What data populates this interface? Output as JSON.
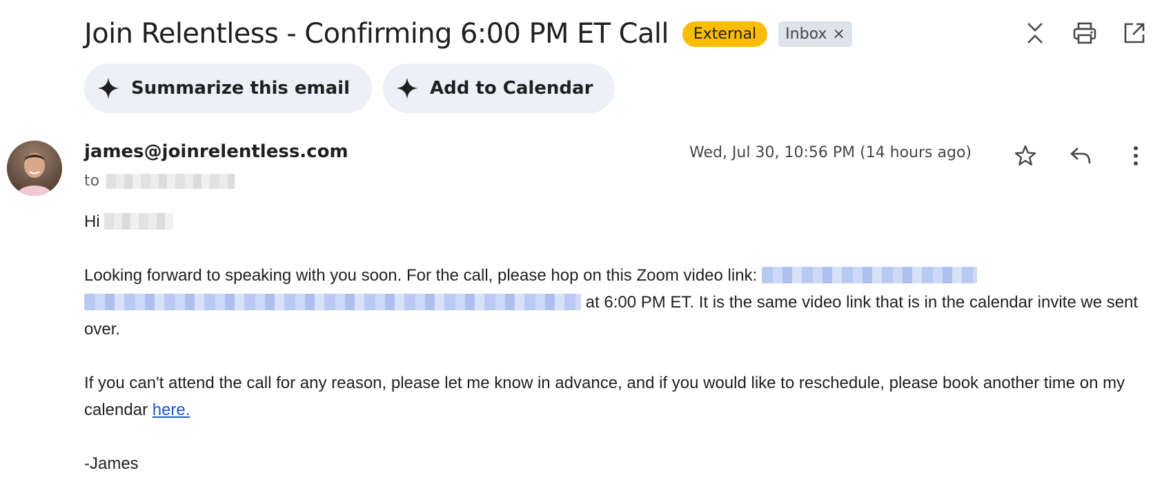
{
  "email": {
    "subject": "Join Relentless - Confirming 6:00 PM ET Call",
    "labels": {
      "external": "External",
      "inbox": "Inbox",
      "inbox_remove": "×"
    },
    "top_actions": [
      "collapse-all-icon",
      "print-icon",
      "open-in-new-window-icon"
    ],
    "ai_actions": [
      {
        "label": "Summarize this email",
        "icon": "sparkle-icon"
      },
      {
        "label": "Add to Calendar",
        "icon": "sparkle-icon"
      }
    ],
    "sender": "james@joinrelentless.com",
    "to_prefix": "to",
    "timestamp": "Wed, Jul 30, 10:56 PM (14 hours ago)",
    "meta_actions": [
      "star-icon",
      "reply-icon",
      "more-vert-icon"
    ],
    "body": {
      "greeting": "Hi",
      "p1_start": "Looking forward to speaking with you soon. For the call, please hop on this Zoom video link: ",
      "p1_end": " at 6:00 PM ET. It is the same video link that is in the calendar invite we sent over.",
      "p2_start": "If you can't attend the call for any reason, please let me know in advance, and if you would like to reschedule, please book another time on my calendar ",
      "p2_link": "here.",
      "signoff": "-James"
    }
  },
  "colors": {
    "external_chip": "#fbbc04",
    "inbox_chip": "#dde3ea",
    "pill_bg": "#edf1f7",
    "link": "#1a56d6"
  }
}
